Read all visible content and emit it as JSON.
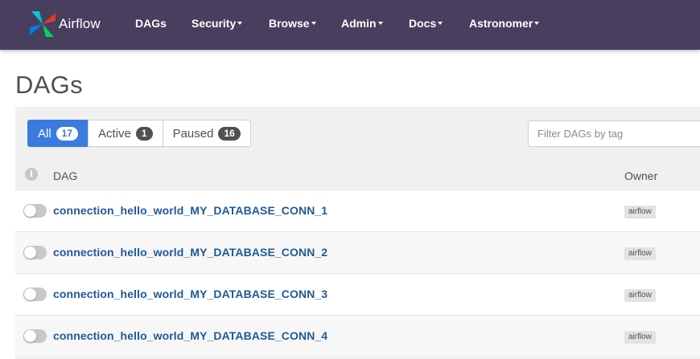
{
  "brand": {
    "name": "Airflow"
  },
  "nav": [
    {
      "label": "DAGs",
      "dropdown": false
    },
    {
      "label": "Security",
      "dropdown": true
    },
    {
      "label": "Browse",
      "dropdown": true
    },
    {
      "label": "Admin",
      "dropdown": true
    },
    {
      "label": "Docs",
      "dropdown": true
    },
    {
      "label": "Astronomer",
      "dropdown": true
    }
  ],
  "page": {
    "title": "DAGs"
  },
  "filters": {
    "all": {
      "label": "All",
      "count": "17"
    },
    "active": {
      "label": "Active",
      "count": "1"
    },
    "paused": {
      "label": "Paused",
      "count": "16"
    },
    "tag_placeholder": "Filter DAGs by tag"
  },
  "table": {
    "info_icon": "i",
    "columns": {
      "dag": "DAG",
      "owner": "Owner"
    },
    "rows": [
      {
        "dag_id": "connection_hello_world_MY_DATABASE_CONN_1",
        "owner": "airflow",
        "paused": true
      },
      {
        "dag_id": "connection_hello_world_MY_DATABASE_CONN_2",
        "owner": "airflow",
        "paused": true
      },
      {
        "dag_id": "connection_hello_world_MY_DATABASE_CONN_3",
        "owner": "airflow",
        "paused": true
      },
      {
        "dag_id": "connection_hello_world_MY_DATABASE_CONN_4",
        "owner": "airflow",
        "paused": true
      }
    ]
  },
  "colors": {
    "navbar": "#483f5f",
    "accent": "#3b7be0",
    "link": "#1f5a94",
    "panel": "#f0f0f0"
  },
  "icons": {
    "brand": "airflow-pinwheel-icon",
    "info": "info-icon",
    "caret": "caret-down-icon"
  }
}
